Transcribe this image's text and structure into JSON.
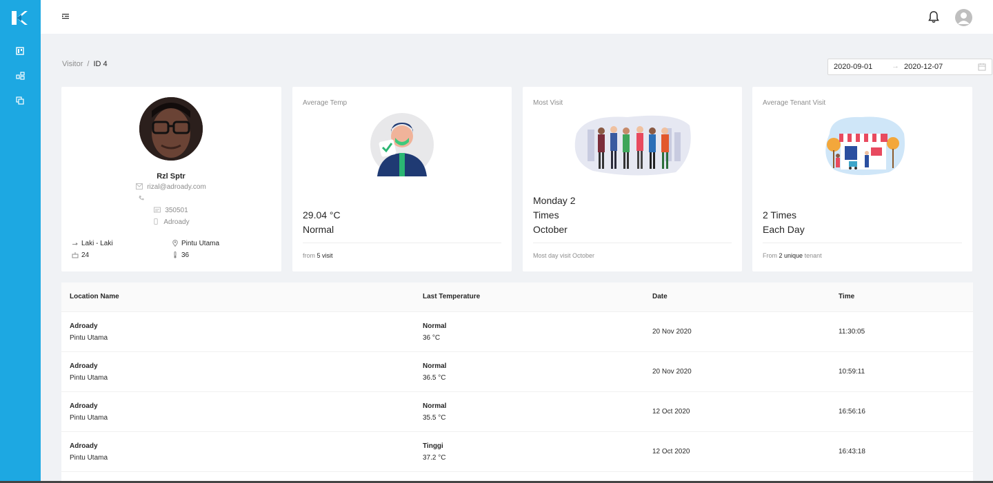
{
  "header": {
    "menu_icon": "menu-fold-icon",
    "bell_icon": "bell-icon",
    "avatar_icon": "user-avatar-icon"
  },
  "sidebar": {
    "items": [
      {
        "icon": "dashboard-icon"
      },
      {
        "icon": "cluster-icon"
      },
      {
        "icon": "copy-icon"
      }
    ]
  },
  "breadcrumb": {
    "parent": "Visitor",
    "separator": "/",
    "current": "ID 4"
  },
  "date_range": {
    "start": "2020-09-01",
    "arrow": "→",
    "end": "2020-12-07"
  },
  "profile": {
    "name": "Rzl Sptr",
    "email": "rizal@adroady.com",
    "phone": "",
    "code": "350501",
    "company": "Adroady",
    "gender": "Laki - Laki",
    "location": "Pintu Utama",
    "age": "24",
    "temp": "36"
  },
  "cards": {
    "avg_temp": {
      "title": "Average Temp",
      "value": "29.04 °C",
      "status": "Normal",
      "foot_prefix": "from",
      "foot_value": "5 visit"
    },
    "most_visit": {
      "title": "Most Visit",
      "line1": "Monday 2",
      "line2": "Times",
      "line3": "October",
      "foot": "Most day visit October"
    },
    "avg_tenant": {
      "title": "Average Tenant Visit",
      "line1": "2 Times",
      "line2": "Each Day",
      "foot_prefix": "From",
      "foot_value": "2 unique",
      "foot_suffix": "tenant"
    }
  },
  "table": {
    "columns": [
      "Location Name",
      "Last Temperature",
      "Date",
      "Time"
    ],
    "rows": [
      {
        "location": "Adroady",
        "gate": "Pintu Utama",
        "status": "Normal",
        "temp": "36 °C",
        "date": "20 Nov 2020",
        "time": "11:30:05"
      },
      {
        "location": "Adroady",
        "gate": "Pintu Utama",
        "status": "Normal",
        "temp": "36.5 °C",
        "date": "20 Nov 2020",
        "time": "10:59:11"
      },
      {
        "location": "Adroady",
        "gate": "Pintu Utama",
        "status": "Normal",
        "temp": "35.5 °C",
        "date": "12 Oct 2020",
        "time": "16:56:16"
      },
      {
        "location": "Adroady",
        "gate": "Pintu Utama",
        "status": "Tinggi",
        "temp": "37.2 °C",
        "date": "12 Oct 2020",
        "time": "16:43:18"
      }
    ]
  },
  "colors": {
    "sidebar": "#1da8e2",
    "background": "#f0f2f5"
  }
}
